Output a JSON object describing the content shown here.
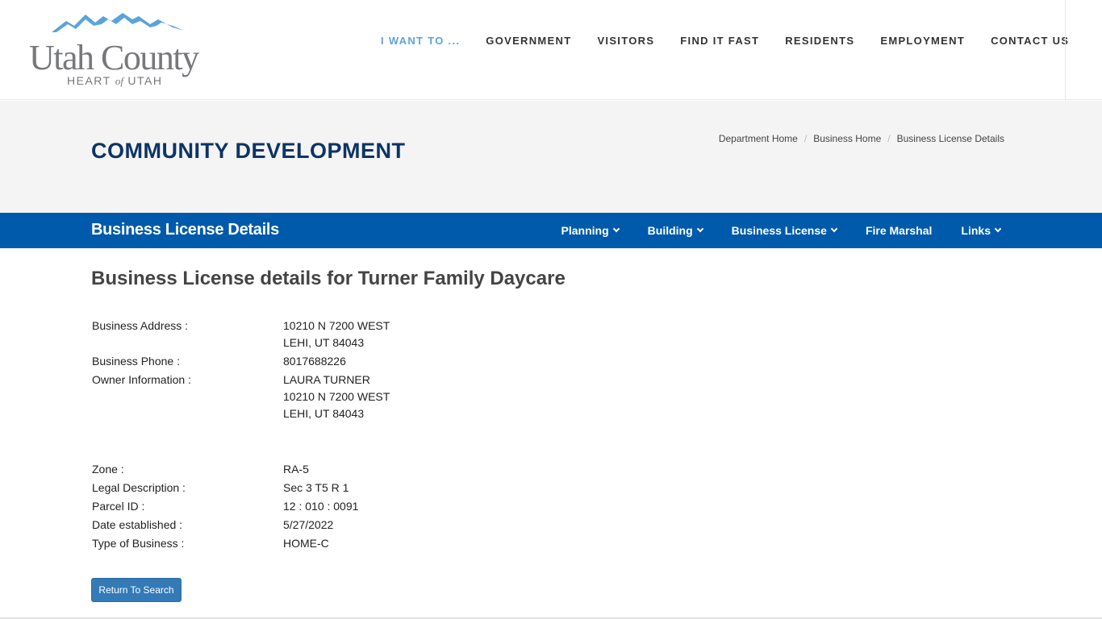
{
  "header": {
    "logo_title": "Utah County",
    "logo_sub_left": "HEART",
    "logo_sub_of": "of",
    "logo_sub_right": "UTAH",
    "nav": [
      {
        "label": "I WANT TO ..."
      },
      {
        "label": "GOVERNMENT"
      },
      {
        "label": "VISITORS"
      },
      {
        "label": "FIND IT FAST"
      },
      {
        "label": "RESIDENTS"
      },
      {
        "label": "EMPLOYMENT"
      },
      {
        "label": "CONTACT US"
      }
    ]
  },
  "title_band": {
    "department": "COMMUNITY DEVELOPMENT",
    "breadcrumb": [
      "Department Home",
      "Business Home",
      "Business License Details"
    ]
  },
  "blue_bar": {
    "title": "Business License Details",
    "menu": [
      {
        "label": "Planning",
        "dropdown": true
      },
      {
        "label": "Building",
        "dropdown": true
      },
      {
        "label": "Business License",
        "dropdown": true
      },
      {
        "label": "Fire Marshal",
        "dropdown": false
      },
      {
        "label": "Links",
        "dropdown": true
      }
    ]
  },
  "content": {
    "heading": "Business License details for Turner Family Daycare",
    "fields": {
      "business_address": {
        "label": "Business Address :",
        "lines": [
          "10210  N   7200 WEST",
          "LEHI, UT  84043"
        ]
      },
      "business_phone": {
        "label": "Business Phone :",
        "value": "8017688226"
      },
      "owner_information": {
        "label": "Owner Information :",
        "lines": [
          "LAURA TURNER",
          "10210 N  7200 WEST",
          "LEHI, UT  84043"
        ]
      },
      "zone": {
        "label": "Zone :",
        "value": "RA-5"
      },
      "legal_description": {
        "label": "Legal Description :",
        "value": "Sec 3 T5 R 1"
      },
      "parcel_id": {
        "label": "Parcel ID :",
        "value": "12 : 010 : 0091"
      },
      "date_established": {
        "label": "Date established :",
        "value": "5/27/2022"
      },
      "type_of_business": {
        "label": "Type of Business :",
        "value": "HOME-C"
      }
    },
    "return_button": "Return To Search"
  },
  "colors": {
    "nav_active": "#5fa3da",
    "department_title": "#0d3466",
    "blue_bar": "#005aab",
    "button": "#337ab7",
    "logo_mountains": "#5ba3db",
    "logo_text": "#77787b"
  },
  "icons": {
    "logo_mark": "mountains-logo-icon",
    "dropdown": "chevron-down-icon"
  }
}
